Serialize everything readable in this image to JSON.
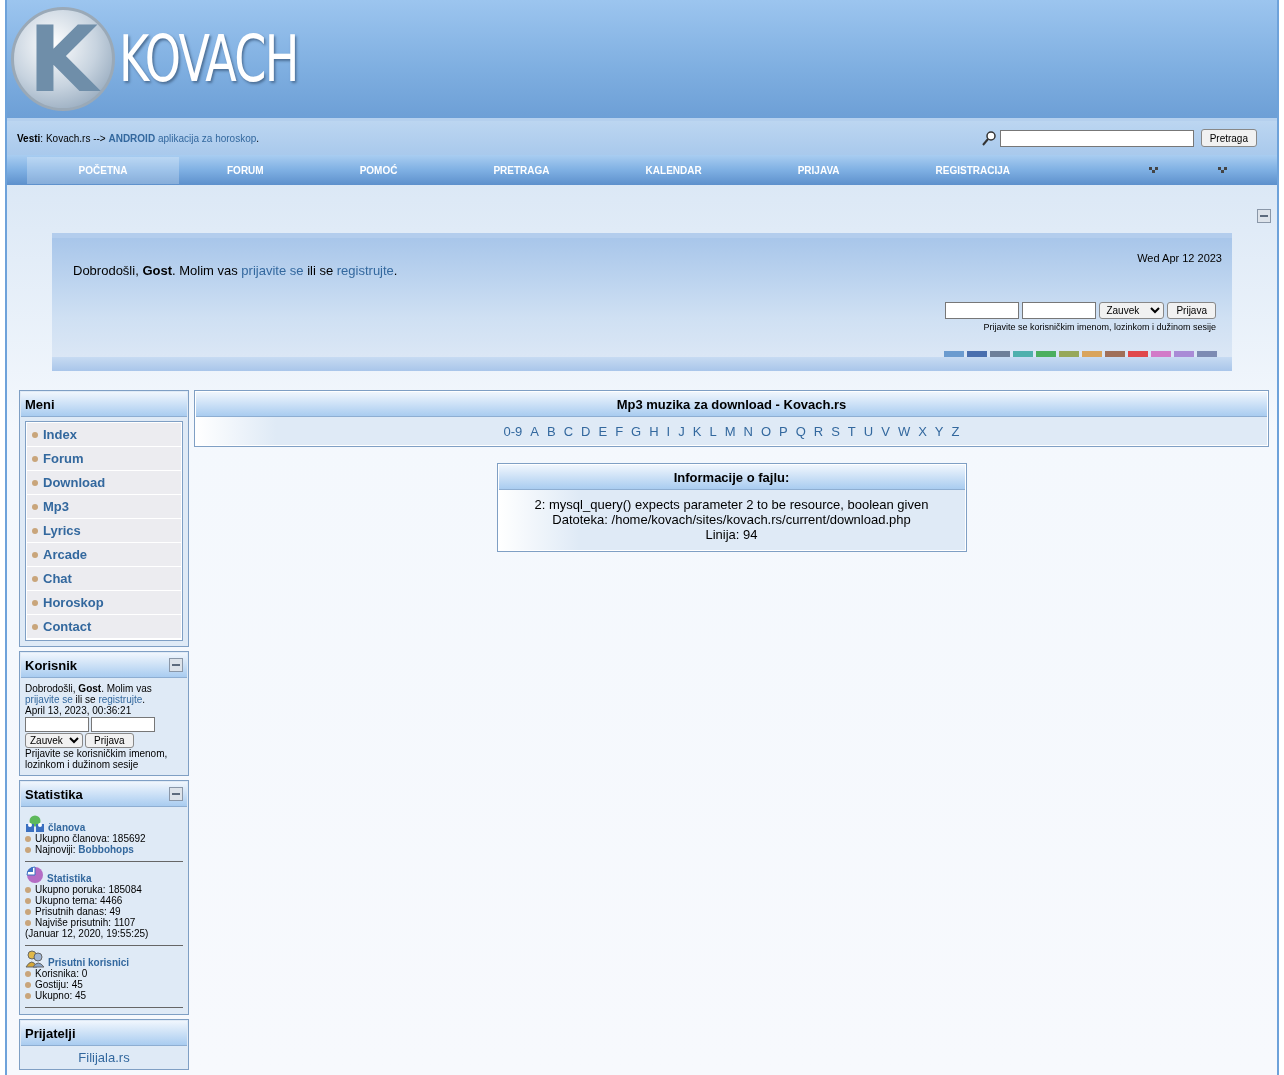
{
  "logo": {
    "badge": "K",
    "text": "KOVACH"
  },
  "news": {
    "prefix": "**Vesti**: Kovach.rs -->",
    "link": "**ANDROID** aplikacija za horoskop",
    "suffix": "."
  },
  "search": {
    "button": "Pretraga"
  },
  "nav": [
    {
      "label": "POČETNA",
      "selected": true
    },
    {
      "label": "FORUM",
      "selected": false
    },
    {
      "label": "POMOĆ",
      "selected": false
    },
    {
      "label": "PRETRAGA",
      "selected": false
    },
    {
      "label": "KALENDAR",
      "selected": false
    },
    {
      "label": "PRIJAVA",
      "selected": false
    },
    {
      "label": "REGISTRACIJA",
      "selected": false
    }
  ],
  "welcome": {
    "greeting": {
      "before": "Dobrodošli, **Gost**. Molim vas",
      "login_link": "prijavite se",
      "middle": "ili se",
      "register_link": "registrujte",
      "end": "."
    },
    "date": "Wed Apr 12 2023",
    "login": {
      "duration": "Zauvek",
      "button": "Prijava",
      "hint": "Prijavite se korisničkim imenom, lozinkom i dužinom sesije"
    },
    "themes": [
      {
        "color": "#6b9bcf"
      },
      {
        "color": "#4a6fae"
      },
      {
        "color": "#6e7f99"
      },
      {
        "color": "#4fb0ad"
      },
      {
        "color": "#4caf5f"
      },
      {
        "color": "#97a85a"
      },
      {
        "color": "#d9a45c"
      },
      {
        "color": "#a0705a"
      },
      {
        "color": "#e0484c"
      },
      {
        "color": "#d27bc8"
      },
      {
        "color": "#a98bd6"
      },
      {
        "color": "#7d8bb3"
      }
    ]
  },
  "menu": {
    "title": "Meni",
    "items": [
      "Index",
      "Forum",
      "Download",
      "Mp3",
      "Lyrics",
      "Arcade",
      "Chat",
      "Horoskop",
      "Contact"
    ]
  },
  "user_block": {
    "title": "Korisnik",
    "greeting": {
      "before": "Dobrodošli, **Gost**. Molim vas",
      "login_link": "prijavite se",
      "middle": "ili se",
      "register_link": "registrujte",
      "end": "."
    },
    "datetime": "April 13, 2023, 00:36:21",
    "duration": "Zauvek",
    "button": "Prijava",
    "hint": "Prijavite se korisničkim imenom, lozinkom i dužinom sesije"
  },
  "stats_block": {
    "title": "Statistika",
    "groups": [
      {
        "kind": "members",
        "title": "članova",
        "lines": [
          {
            "kind": "bullet",
            "text": "Ukupno članova: 185692"
          },
          {
            "kind": "bullet",
            "text": "Najnoviji:",
            "link": "Bobbohops"
          }
        ]
      },
      {
        "kind": "stats",
        "title": "Statistika",
        "lines": [
          {
            "kind": "bullet",
            "text": "Ukupno poruka: 185084"
          },
          {
            "kind": "bullet",
            "text": "Ukupno tema: 4466"
          },
          {
            "kind": "bullet",
            "text": "Prisutnih danas: 49"
          },
          {
            "kind": "bullet",
            "text": "Najviše prisutnih: 1107"
          },
          {
            "kind": "plain",
            "text": "(Januar 12, 2020, 19:55:25)"
          }
        ]
      },
      {
        "kind": "online",
        "title": "Prisutni korisnici",
        "lines": [
          {
            "kind": "bullet",
            "text": "Korisnika: 0"
          },
          {
            "kind": "bullet",
            "text": "Gostiju: 45"
          },
          {
            "kind": "bullet",
            "text": "Ukupno: 45"
          }
        ]
      }
    ]
  },
  "friends_block": {
    "title": "Prijatelji",
    "link": "Filijala.rs"
  },
  "main": {
    "title": "Mp3 muzika za download - Kovach.rs",
    "letters": [
      "0-9",
      "A",
      "B",
      "C",
      "D",
      "E",
      "F",
      "G",
      "H",
      "I",
      "J",
      "K",
      "L",
      "M",
      "N",
      "O",
      "P",
      "Q",
      "R",
      "S",
      "T",
      "U",
      "V",
      "W",
      "X",
      "Y",
      "Z"
    ],
    "info": {
      "title": "Informacije o fajlu:",
      "lines": [
        "2: mysql_query() expects parameter 2 to be resource, boolean given",
        "Datoteka: /home/kovach/sites/kovach.rs/current/download.php",
        "Linija: 94"
      ]
    }
  }
}
